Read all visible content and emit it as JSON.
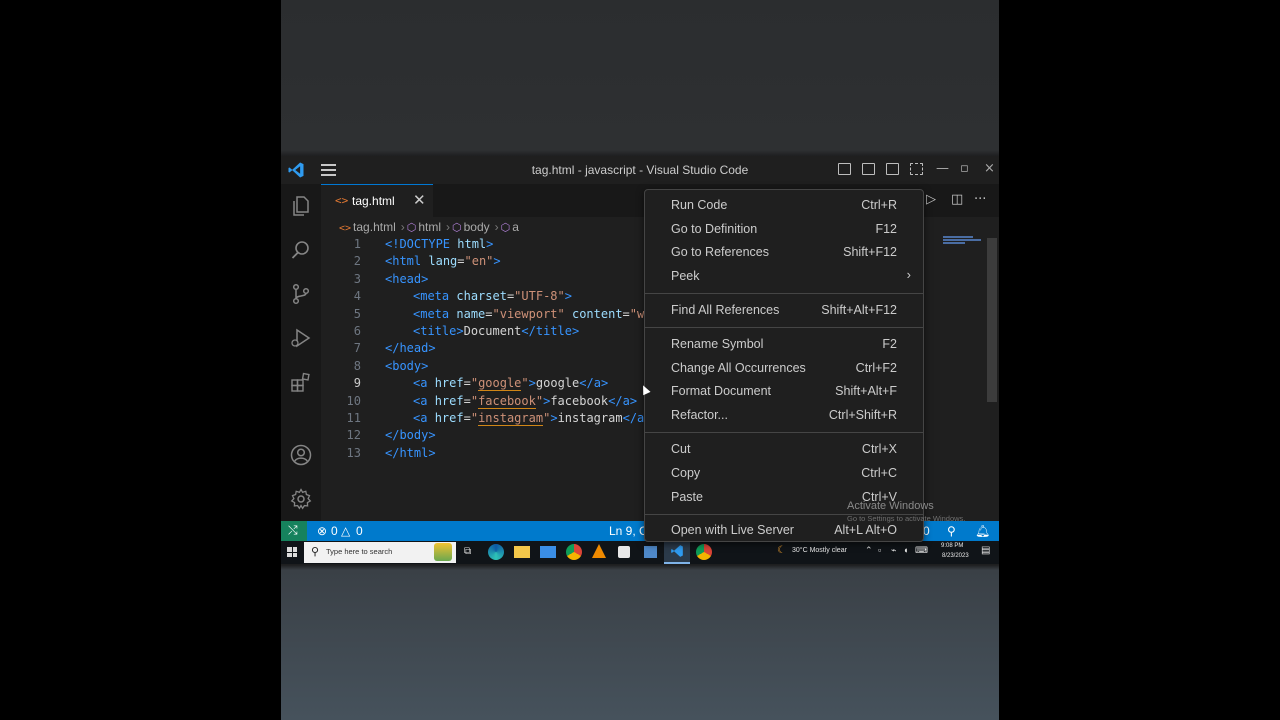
{
  "window": {
    "title": "tag.html - javascript - Visual Studio Code",
    "controls": {
      "minimize": "—",
      "restore": "▫",
      "close": "×"
    }
  },
  "tab": {
    "icon": "<>",
    "label": "tag.html",
    "close": "✕"
  },
  "tab_actions": {
    "run": "▷",
    "split": "◫",
    "more": "···"
  },
  "breadcrumb": [
    "tag.html",
    "html",
    "body",
    "a"
  ],
  "line_numbers": [
    "1",
    "2",
    "3",
    "4",
    "5",
    "6",
    "7",
    "8",
    "9",
    "10",
    "11",
    "12",
    "13"
  ],
  "code": {
    "l1": {
      "open": "<!",
      "tag": "DOCTYPE",
      "attr": " html",
      "close": ">"
    },
    "l2": {
      "open": "<",
      "tag": "html",
      "attr": " lang",
      "eq": "=",
      "val": "\"en\"",
      "close": ">"
    },
    "l3": {
      "open": "<",
      "tag": "head",
      "close": ">"
    },
    "l4": {
      "open": "<",
      "tag": "meta",
      "attr": " charset",
      "eq": "=",
      "val": "\"UTF-8\"",
      "close": ">"
    },
    "l5": {
      "open": "<",
      "tag": "meta",
      "attr": " name",
      "eq": "=",
      "val": "\"viewport\"",
      "attr2": " content",
      "eq2": "=",
      "val2": "\"wi"
    },
    "l6": {
      "open": "<",
      "tag": "title",
      "close": ">",
      "text": "Document",
      "open2": "</",
      "tag2": "title",
      "close2": ">"
    },
    "l7": {
      "open": "</",
      "tag": "head",
      "close": ">"
    },
    "l8": {
      "open": "<",
      "tag": "body",
      "close": ">"
    },
    "l9": {
      "open": "<",
      "tag": "a",
      "attr": " href",
      "eq": "=",
      "q1": "\"",
      "val": "google",
      "q2": "\"",
      "close": ">",
      "text": "google",
      "open2": "</",
      "tag2": "a",
      "close2": ">"
    },
    "l10": {
      "open": "<",
      "tag": "a",
      "attr": " href",
      "eq": "=",
      "q1": "\"",
      "val": "facebook",
      "q2": "\"",
      "close": ">",
      "text": "facebook",
      "open2": "</",
      "tag2": "a",
      "close2": ">"
    },
    "l11": {
      "open": "<",
      "tag": "a",
      "attr": " href",
      "eq": "=",
      "q1": "\"",
      "val": "instagram",
      "q2": "\"",
      "close": ">",
      "text": "instagram",
      "open2": "</",
      "tag2": "a",
      "close2": ">"
    },
    "l12": {
      "open": "</",
      "tag": "body",
      "close": ">"
    },
    "l13": {
      "open": "</",
      "tag": "html",
      "close": ">"
    }
  },
  "context_menu": {
    "items": [
      {
        "label": "Run Code",
        "key": "Ctrl+R"
      },
      {
        "label": "Go to Definition",
        "key": "F12"
      },
      {
        "label": "Go to References",
        "key": "Shift+F12"
      },
      {
        "label": "Peek",
        "key": "›"
      },
      {
        "label": "Find All References",
        "key": "Shift+Alt+F12"
      },
      {
        "label": "Rename Symbol",
        "key": "F2"
      },
      {
        "label": "Change All Occurrences",
        "key": "Ctrl+F2"
      },
      {
        "label": "Format Document",
        "key": "Shift+Alt+F"
      },
      {
        "label": "Refactor...",
        "key": "Ctrl+Shift+R"
      },
      {
        "label": "Cut",
        "key": "Ctrl+X"
      },
      {
        "label": "Copy",
        "key": "Ctrl+C"
      },
      {
        "label": "Paste",
        "key": "Ctrl+V"
      },
      {
        "label": "Open with Live Server",
        "key": "Alt+L Alt+O"
      }
    ]
  },
  "status": {
    "remote": "⤭",
    "errors": "0",
    "warnings": "0",
    "cursor": "Ln 9, C",
    "port": "0"
  },
  "watermark": {
    "title": "Activate Windows",
    "subtitle": "Go to Settings to activate Windows."
  },
  "taskbar": {
    "search_placeholder": "Type here to search",
    "weather": "30°C  Mostly clear",
    "time": "9:08 PM",
    "date": "8/23/2023"
  }
}
